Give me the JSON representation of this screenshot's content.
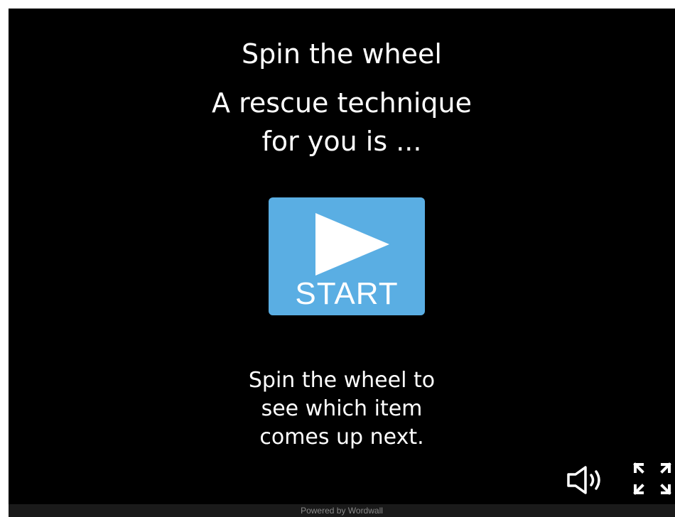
{
  "game": {
    "title_line1": "Spin the wheel",
    "title_line2": "A rescue technique",
    "title_line3": "for you is ...",
    "start_label": "START",
    "instructions": [
      "Spin the wheel to",
      "see which item",
      "comes up next."
    ]
  },
  "controls": {
    "sound_icon": "speaker-icon",
    "fullscreen_icon": "fullscreen-icon"
  },
  "footer": {
    "text": "Powered by Wordwall"
  },
  "colors": {
    "stage_background": "#000000",
    "start_button": "#5aaee3",
    "text": "#ffffff"
  }
}
